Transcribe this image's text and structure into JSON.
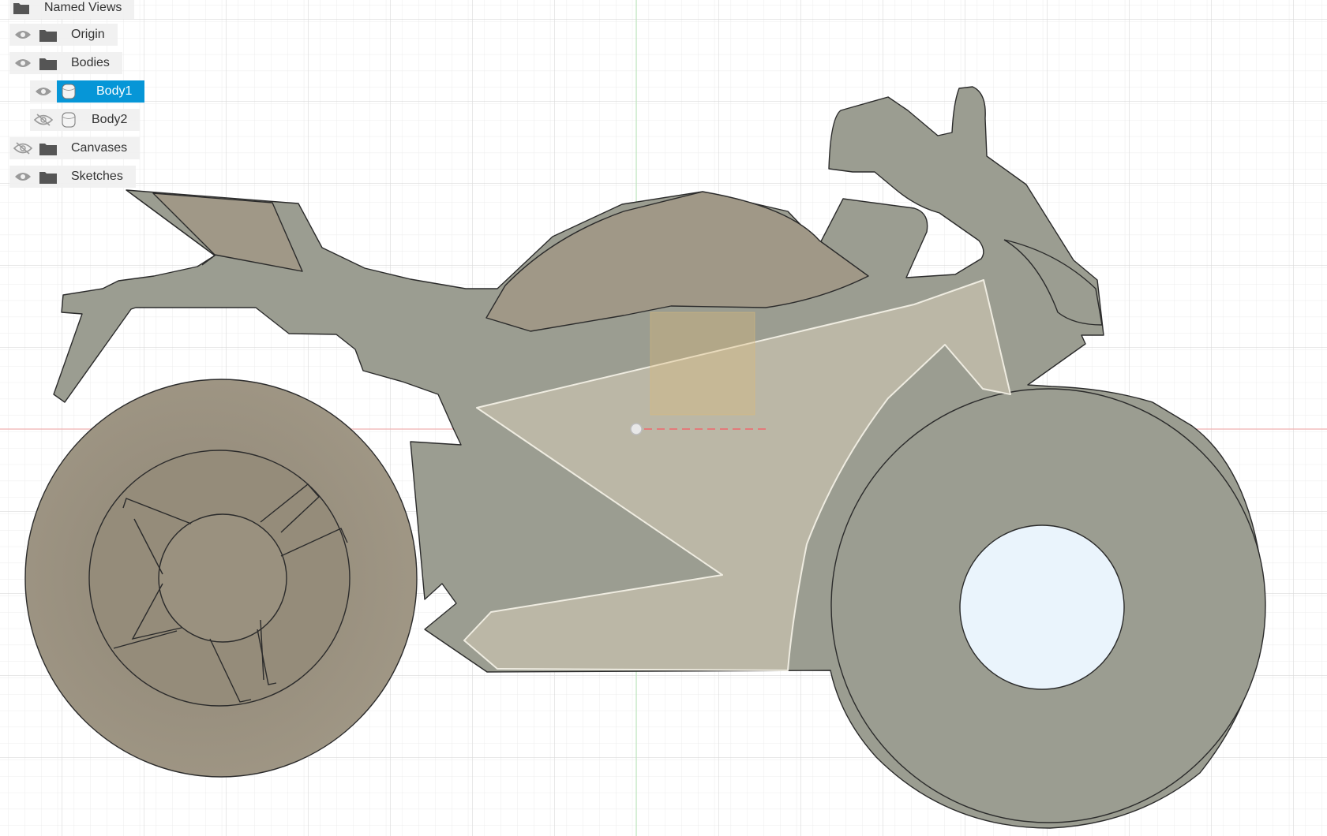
{
  "browser": {
    "items": [
      {
        "label": "Named Views",
        "type": "folder",
        "visibility": "none"
      },
      {
        "label": "Origin",
        "type": "folder",
        "visibility": "visible"
      },
      {
        "label": "Bodies",
        "type": "folder",
        "visibility": "visible"
      },
      {
        "label": "Body1",
        "type": "body",
        "visibility": "visible",
        "selected": true
      },
      {
        "label": "Body2",
        "type": "body",
        "visibility": "hidden"
      },
      {
        "label": "Canvases",
        "type": "folder",
        "visibility": "hidden"
      },
      {
        "label": "Sketches",
        "type": "folder",
        "visibility": "visible"
      }
    ]
  },
  "colors": {
    "canvas_bg": "#ffffff",
    "grid_line": "#e3e3e3",
    "grid_major": "#cfcfcf",
    "axis_x": "#f0a0a0",
    "axis_y": "#a8dca8",
    "body_fill": "#9c9d8f",
    "wheel_fill": "#9a907e",
    "tank_fill": "#a09887",
    "fairing_fill": "#bdb8a6",
    "hole_fill": "#eaf4fc",
    "selection": "#0696d7"
  }
}
